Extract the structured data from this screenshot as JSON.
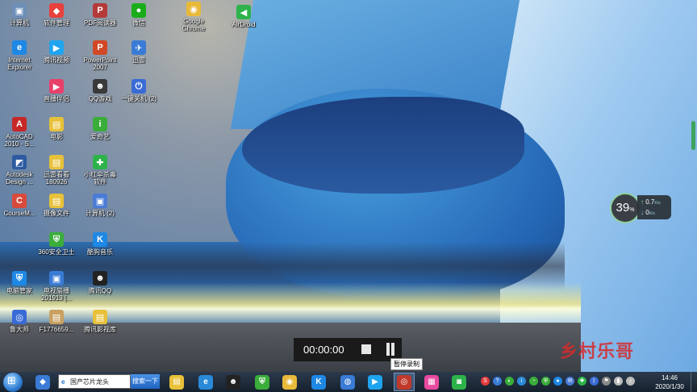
{
  "desktop_icons": [
    {
      "label": "计算机",
      "color": "#6d8fb8",
      "glyph": "▣"
    },
    {
      "label": "软件管理",
      "color": "#e8403b",
      "glyph": "◆"
    },
    {
      "label": "PDF阅读器",
      "color": "#b43a3a",
      "glyph": "P"
    },
    {
      "label": "微信",
      "color": "#1aad19",
      "glyph": "●"
    },
    {
      "label": "Google\nChrome",
      "color": "#e8b93a",
      "glyph": "◉"
    },
    {
      "label": "AirDroid",
      "color": "#2db34a",
      "glyph": "◀"
    },
    {
      "label": "Internet\nExplorer",
      "color": "#1e88e5",
      "glyph": "e"
    },
    {
      "label": "腾讯视频",
      "color": "#1fa5f0",
      "glyph": "▶"
    },
    {
      "label": "PowerPoint\n2007",
      "color": "#d24726",
      "glyph": "P"
    },
    {
      "label": "迅雷",
      "color": "#3a7bd5",
      "glyph": "✈"
    },
    {
      "label": "直播伴侣",
      "color": "#e8406b",
      "glyph": "▶"
    },
    {
      "label": "QQ游戏",
      "color": "#3a3a3a",
      "glyph": "☻"
    },
    {
      "label": "一键关机 (2)",
      "color": "#3a6bd5",
      "glyph": "⏻"
    },
    {
      "label": "AutoCAD\n2010 - S...",
      "color": "#c62828",
      "glyph": "A"
    },
    {
      "label": "电影",
      "color": "#e8c13a",
      "glyph": "▤"
    },
    {
      "label": "爱奇艺",
      "color": "#3aad3a",
      "glyph": "i"
    },
    {
      "label": "Autodesk\nDesign ...",
      "color": "#2d5aa0",
      "glyph": "◩"
    },
    {
      "label": "迅雷看看\n180926",
      "color": "#e8c13a",
      "glyph": "▤"
    },
    {
      "label": "小红伞杀毒\n软件",
      "color": "#2db34a",
      "glyph": "✚"
    },
    {
      "label": "CourseM...",
      "color": "#d84a3a",
      "glyph": "C"
    },
    {
      "label": "摄像文件",
      "color": "#e8c13a",
      "glyph": "▤"
    },
    {
      "label": "计算机 (2)",
      "color": "#4a7bd5",
      "glyph": "▣"
    },
    {
      "label": "360安全卫士",
      "color": "#3aad3a",
      "glyph": "⛨"
    },
    {
      "label": "酷狗音乐",
      "color": "#1e88e5",
      "glyph": "K"
    },
    {
      "label": "电脑管家",
      "color": "#1e88e5",
      "glyph": "⛨"
    },
    {
      "label": "电视猫播\n201913 [...",
      "color": "#3a7bd5",
      "glyph": "▣"
    },
    {
      "label": "腾讯QQ",
      "color": "#222222",
      "glyph": "☻"
    },
    {
      "label": "鲁大师",
      "color": "#3a6bd5",
      "glyph": "◎"
    },
    {
      "label": "F1776659...",
      "color": "#c8a060",
      "glyph": "▤"
    },
    {
      "label": "腾讯影视库",
      "color": "#e8c13a",
      "glyph": "▤"
    }
  ],
  "recorder": {
    "time": "00:00:00",
    "stop_label": "停止",
    "tooltip": "暂停录制"
  },
  "watermark": "乡村乐哥",
  "speed_widget": {
    "percent": "39",
    "percent_sign": "%",
    "upload": "0.7",
    "upload_unit": "K/s",
    "download": "0",
    "download_unit": "K/s"
  },
  "taskbar": {
    "search_text": "国产芯片龙头",
    "search_button": "搜索一下",
    "apps": [
      {
        "name": "folder",
        "color": "#e8c13a",
        "glyph": "▤"
      },
      {
        "name": "edge",
        "color": "#2a8ad8",
        "glyph": "e"
      },
      {
        "name": "qq-penguin",
        "color": "#222222",
        "glyph": "☻"
      },
      {
        "name": "360",
        "color": "#3aad3a",
        "glyph": "⛨"
      },
      {
        "name": "chrome",
        "color": "#e8b93a",
        "glyph": "◉"
      },
      {
        "name": "kugou",
        "color": "#1e88e5",
        "glyph": "K"
      },
      {
        "name": "qq-browser",
        "color": "#3a7bd5",
        "glyph": "◍"
      },
      {
        "name": "tencent-video",
        "color": "#1fa5f0",
        "glyph": "▶"
      },
      {
        "name": "recorder",
        "color": "#c0392b",
        "glyph": "◎"
      },
      {
        "name": "metro",
        "color": "#e84aa0",
        "glyph": "▦"
      },
      {
        "name": "aiqiyi-app",
        "color": "#2db34a",
        "glyph": "◙"
      }
    ],
    "tray_icons": [
      {
        "name": "sogou-ime",
        "color": "#e23b3b",
        "glyph": "S"
      },
      {
        "name": "help",
        "color": "#3a7bd5",
        "glyph": "?"
      },
      {
        "name": "shield",
        "color": "#3aad3a",
        "glyph": "◐"
      },
      {
        "name": "info",
        "color": "#2d8ad8",
        "glyph": "i"
      },
      {
        "name": "net-speed",
        "color": "#3aad3a",
        "glyph": "◔"
      },
      {
        "name": "security",
        "color": "#3aad3a",
        "glyph": "⛨"
      },
      {
        "name": "chat",
        "color": "#1e88e5",
        "glyph": "●"
      },
      {
        "name": "mail",
        "color": "#4a7bd5",
        "glyph": "✉"
      },
      {
        "name": "antivirus",
        "color": "#2db34a",
        "glyph": "✚"
      },
      {
        "name": "bluetooth",
        "color": "#3a6bd5",
        "glyph": "ᛒ"
      },
      {
        "name": "flag",
        "color": "#888888",
        "glyph": "⚑"
      },
      {
        "name": "network",
        "color": "#bbbbbb",
        "glyph": "▮"
      },
      {
        "name": "volume",
        "color": "#bbbbbb",
        "glyph": "♪"
      }
    ],
    "clock_time": "14:46",
    "clock_date": "2020/1/30"
  }
}
